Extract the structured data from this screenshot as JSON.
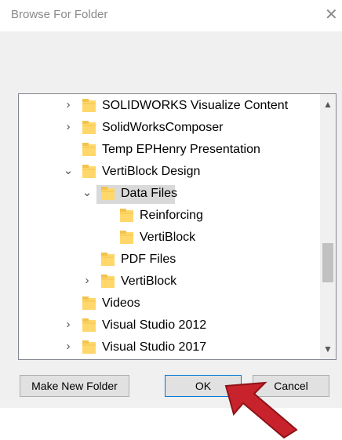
{
  "dialog": {
    "title": "Browse For Folder",
    "close_glyph": "✕",
    "description": ""
  },
  "tree": {
    "items": [
      {
        "label": "SOLIDWORKS Visualize Content",
        "expander": "›"
      },
      {
        "label": "SolidWorksComposer",
        "expander": "›"
      },
      {
        "label": "Temp EPHenry Presentation",
        "expander": ""
      },
      {
        "label": "VertiBlock Design",
        "expander": "⌄"
      },
      {
        "label": "Data Files",
        "expander": "⌄",
        "selected": true
      },
      {
        "label": "Reinforcing",
        "expander": ""
      },
      {
        "label": "VertiBlock",
        "expander": ""
      },
      {
        "label": "PDF Files",
        "expander": ""
      },
      {
        "label": "VertiBlock",
        "expander": "›"
      },
      {
        "label": "Videos",
        "expander": ""
      },
      {
        "label": "Visual Studio 2012",
        "expander": "›"
      },
      {
        "label": "Visual Studio 2017",
        "expander": "›"
      }
    ],
    "scroll_up_glyph": "▲",
    "scroll_down_glyph": "▼"
  },
  "buttons": {
    "make_new_folder": "Make New Folder",
    "ok": "OK",
    "cancel": "Cancel"
  },
  "icons": {
    "folder": "folder-icon",
    "pointer": "pointer-arrow-icon"
  },
  "colors": {
    "folder_fill": "#ffd76b",
    "folder_tab": "#f2c44d",
    "selection": "#d9d9d9",
    "arrow": "#c8232c"
  }
}
